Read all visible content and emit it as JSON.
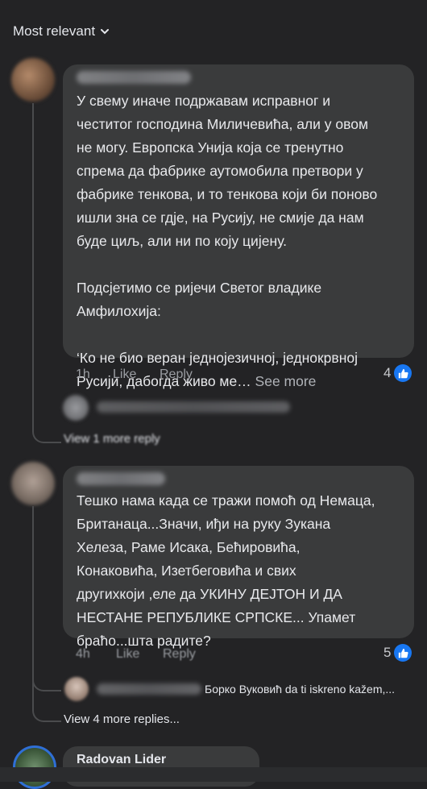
{
  "sort": {
    "label": "Most relevant",
    "icon": "chevron-down-icon"
  },
  "comments": [
    {
      "author": "",
      "text": "У свему иначе подржавам исправног и\nчеститог господина Миличевића, али у овом\nне могу. Европска Унија која се тренутно\nспрема да фабрике аутомобила претвори у\nфабрике тенкова, и то тенкова који би поново\nишли зна се гдје, на Русију, не смије да нам\nбуде циљ, али ни по коју цијену.\n\nПодсјетимо се ријечи Светог владике\nАмфилохија:\n\n‘Ко не био веран једнојезичној, једнокрвној\nРусији, дабогда живо ме…",
      "see_more": " See more",
      "time": "1h",
      "like": "Like",
      "reply": "Reply",
      "reactions": "4",
      "reply_preview": "",
      "more_replies": "View 1 more reply"
    },
    {
      "author": "",
      "text": "Тешко нама када се тражи помоћ од Немаца,\nБританаца...Значи, иђи на руку Зукана\nХелеза, Раме Исака, Бећировића,\nКонаковића, Изетбеговића и свих\nдругихкоји ,еле да УКИНУ ДЕЈТОН И ДА\nНЕСТАНЕ РЕПУБЛИКЕ СРПСКЕ... Упамет\nбраћо...шта радите?",
      "time": "4h",
      "like": "Like",
      "reply": "Reply",
      "reactions": "5",
      "reply_preview": "Борко Вуковић da ti iskreno kažem,...",
      "more_replies": "View 4 more replies..."
    },
    {
      "author": "Radovan Lider"
    }
  ],
  "colors": {
    "background": "#232325",
    "bubble": "#3a3b3c",
    "like_blue": "#1877f2"
  }
}
